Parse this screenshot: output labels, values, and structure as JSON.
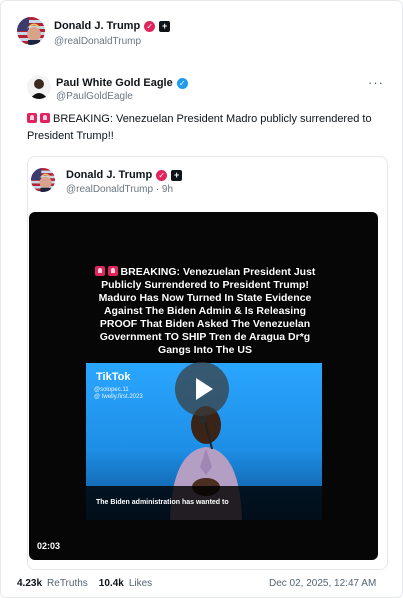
{
  "main_post": {
    "author_name": "Donald J. Trump",
    "author_handle": "@realDonaldTrump",
    "avatar_icon": "trump-avatar",
    "verified_color": "#e0245e"
  },
  "reshared_post": {
    "author_name": "Paul White Gold Eagle",
    "author_handle": "@PaulGoldEagle",
    "more_label": "···",
    "verified_color": "#1d9bf0",
    "text": "BREAKING: Venezuelan President Madro publicly surrendered to President Trump!!",
    "prefix_icons": [
      "siren-icon",
      "siren-icon"
    ]
  },
  "quoted_post": {
    "author_name": "Donald J. Trump",
    "author_handle": "@realDonaldTrump · 9h",
    "video": {
      "caption": "BREAKING: Venezuelan President Just Publicly Surrendered to President Trump! Maduro Has Now Turned In State Evidence Against The Biden Admin & Is Releasing PROOF That Biden Asked The Venezuelan Government TO SHIP Tren de Aragua Dr*g Gangs Into The US",
      "tiktok_label": "TikTok",
      "tiktok_user": "@solopec.11",
      "tiktok_sub": "@ twelly.first.2023",
      "subtitle": "The Biden administration has wanted to",
      "duration": "02:03"
    }
  },
  "stats": {
    "retruths_count": "4.23k",
    "retruths_label": "ReTruths",
    "likes_count": "10.4k",
    "likes_label": "Likes",
    "date": "Dec 02, 2025, 12:47 AM"
  }
}
